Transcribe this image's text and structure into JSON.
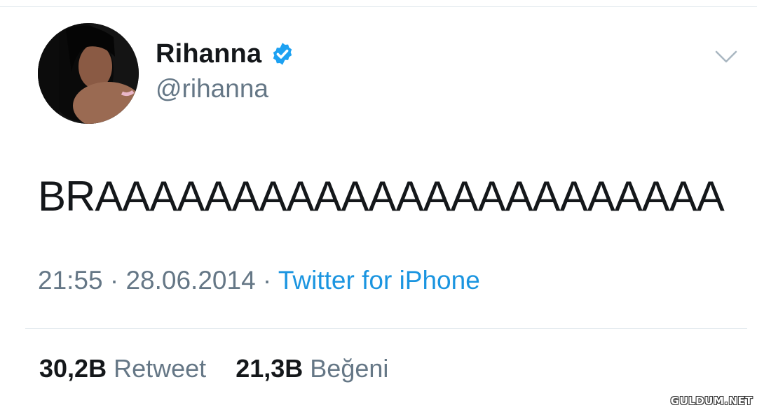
{
  "tweet": {
    "author": {
      "display_name": "Rihanna",
      "handle": "@rihanna",
      "verified": true,
      "verified_icon": "verified-badge-icon"
    },
    "text": "BRAAAAAAAAAAAAAAAAAAAAAAA",
    "timestamp": "21:55 · 28.06.2014 · ",
    "source": "Twitter for iPhone",
    "stats": {
      "retweets_count": "30,2B",
      "retweets_label": "Retweet",
      "likes_count": "21,3B",
      "likes_label": "Beğeni"
    },
    "menu_icon": "chevron-down-icon"
  },
  "watermark": "GULDUM.NET",
  "colors": {
    "primary_text": "#14171a",
    "secondary_text": "#657786",
    "link": "#1b95e0",
    "verified_badge": "#1da1f2",
    "divider": "#e6ecf0"
  }
}
